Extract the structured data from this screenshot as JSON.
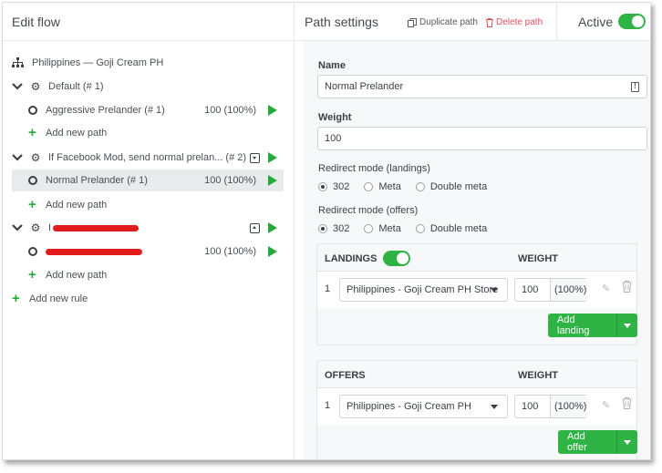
{
  "left": {
    "title": "Edit flow",
    "campaign": "Philippines — Goji Cream PH",
    "rules": [
      {
        "name": "Default (# 1)",
        "paths": [
          {
            "name": "Aggressive Prelander (# 1)",
            "weight": "100 (100%)"
          }
        ],
        "add_path": "Add new path"
      },
      {
        "name": "If Facebook Mod, send normal prelan... (# 2)",
        "paths": [
          {
            "name": "Normal Prelander (# 1)",
            "weight": "100 (100%)"
          }
        ],
        "add_path": "Add new path"
      },
      {
        "name": "I",
        "paths": [
          {
            "name": "",
            "weight": "100 (100%)"
          }
        ],
        "add_path": "Add new path"
      }
    ],
    "add_rule": "Add new rule"
  },
  "right": {
    "title": "Path settings",
    "duplicate": "Duplicate path",
    "delete": "Delete path",
    "active_label": "Active",
    "name_label": "Name",
    "name_value": "Normal Prelander",
    "weight_label": "Weight",
    "weight_value": "100",
    "redirect_landings_label": "Redirect mode (landings)",
    "redirect_offers_label": "Redirect mode (offers)",
    "redirect_options": [
      "302",
      "Meta",
      "Double meta"
    ],
    "landings": {
      "header": "LANDINGS",
      "weight_header": "WEIGHT",
      "rows": [
        {
          "index": "1",
          "name": "Philippines - Goji Cream PH Store",
          "weight": "100",
          "percent": "(100%)"
        }
      ],
      "add_button": "Add landing"
    },
    "offers": {
      "header": "OFFERS",
      "weight_header": "WEIGHT",
      "rows": [
        {
          "index": "1",
          "name": "Philippines - Goji Cream PH",
          "weight": "100",
          "percent": "(100%)"
        }
      ],
      "add_button": "Add offer"
    }
  },
  "colors": {
    "accent": "#2fb344",
    "delete": "#e0525b",
    "redact": "#e21c1c"
  }
}
